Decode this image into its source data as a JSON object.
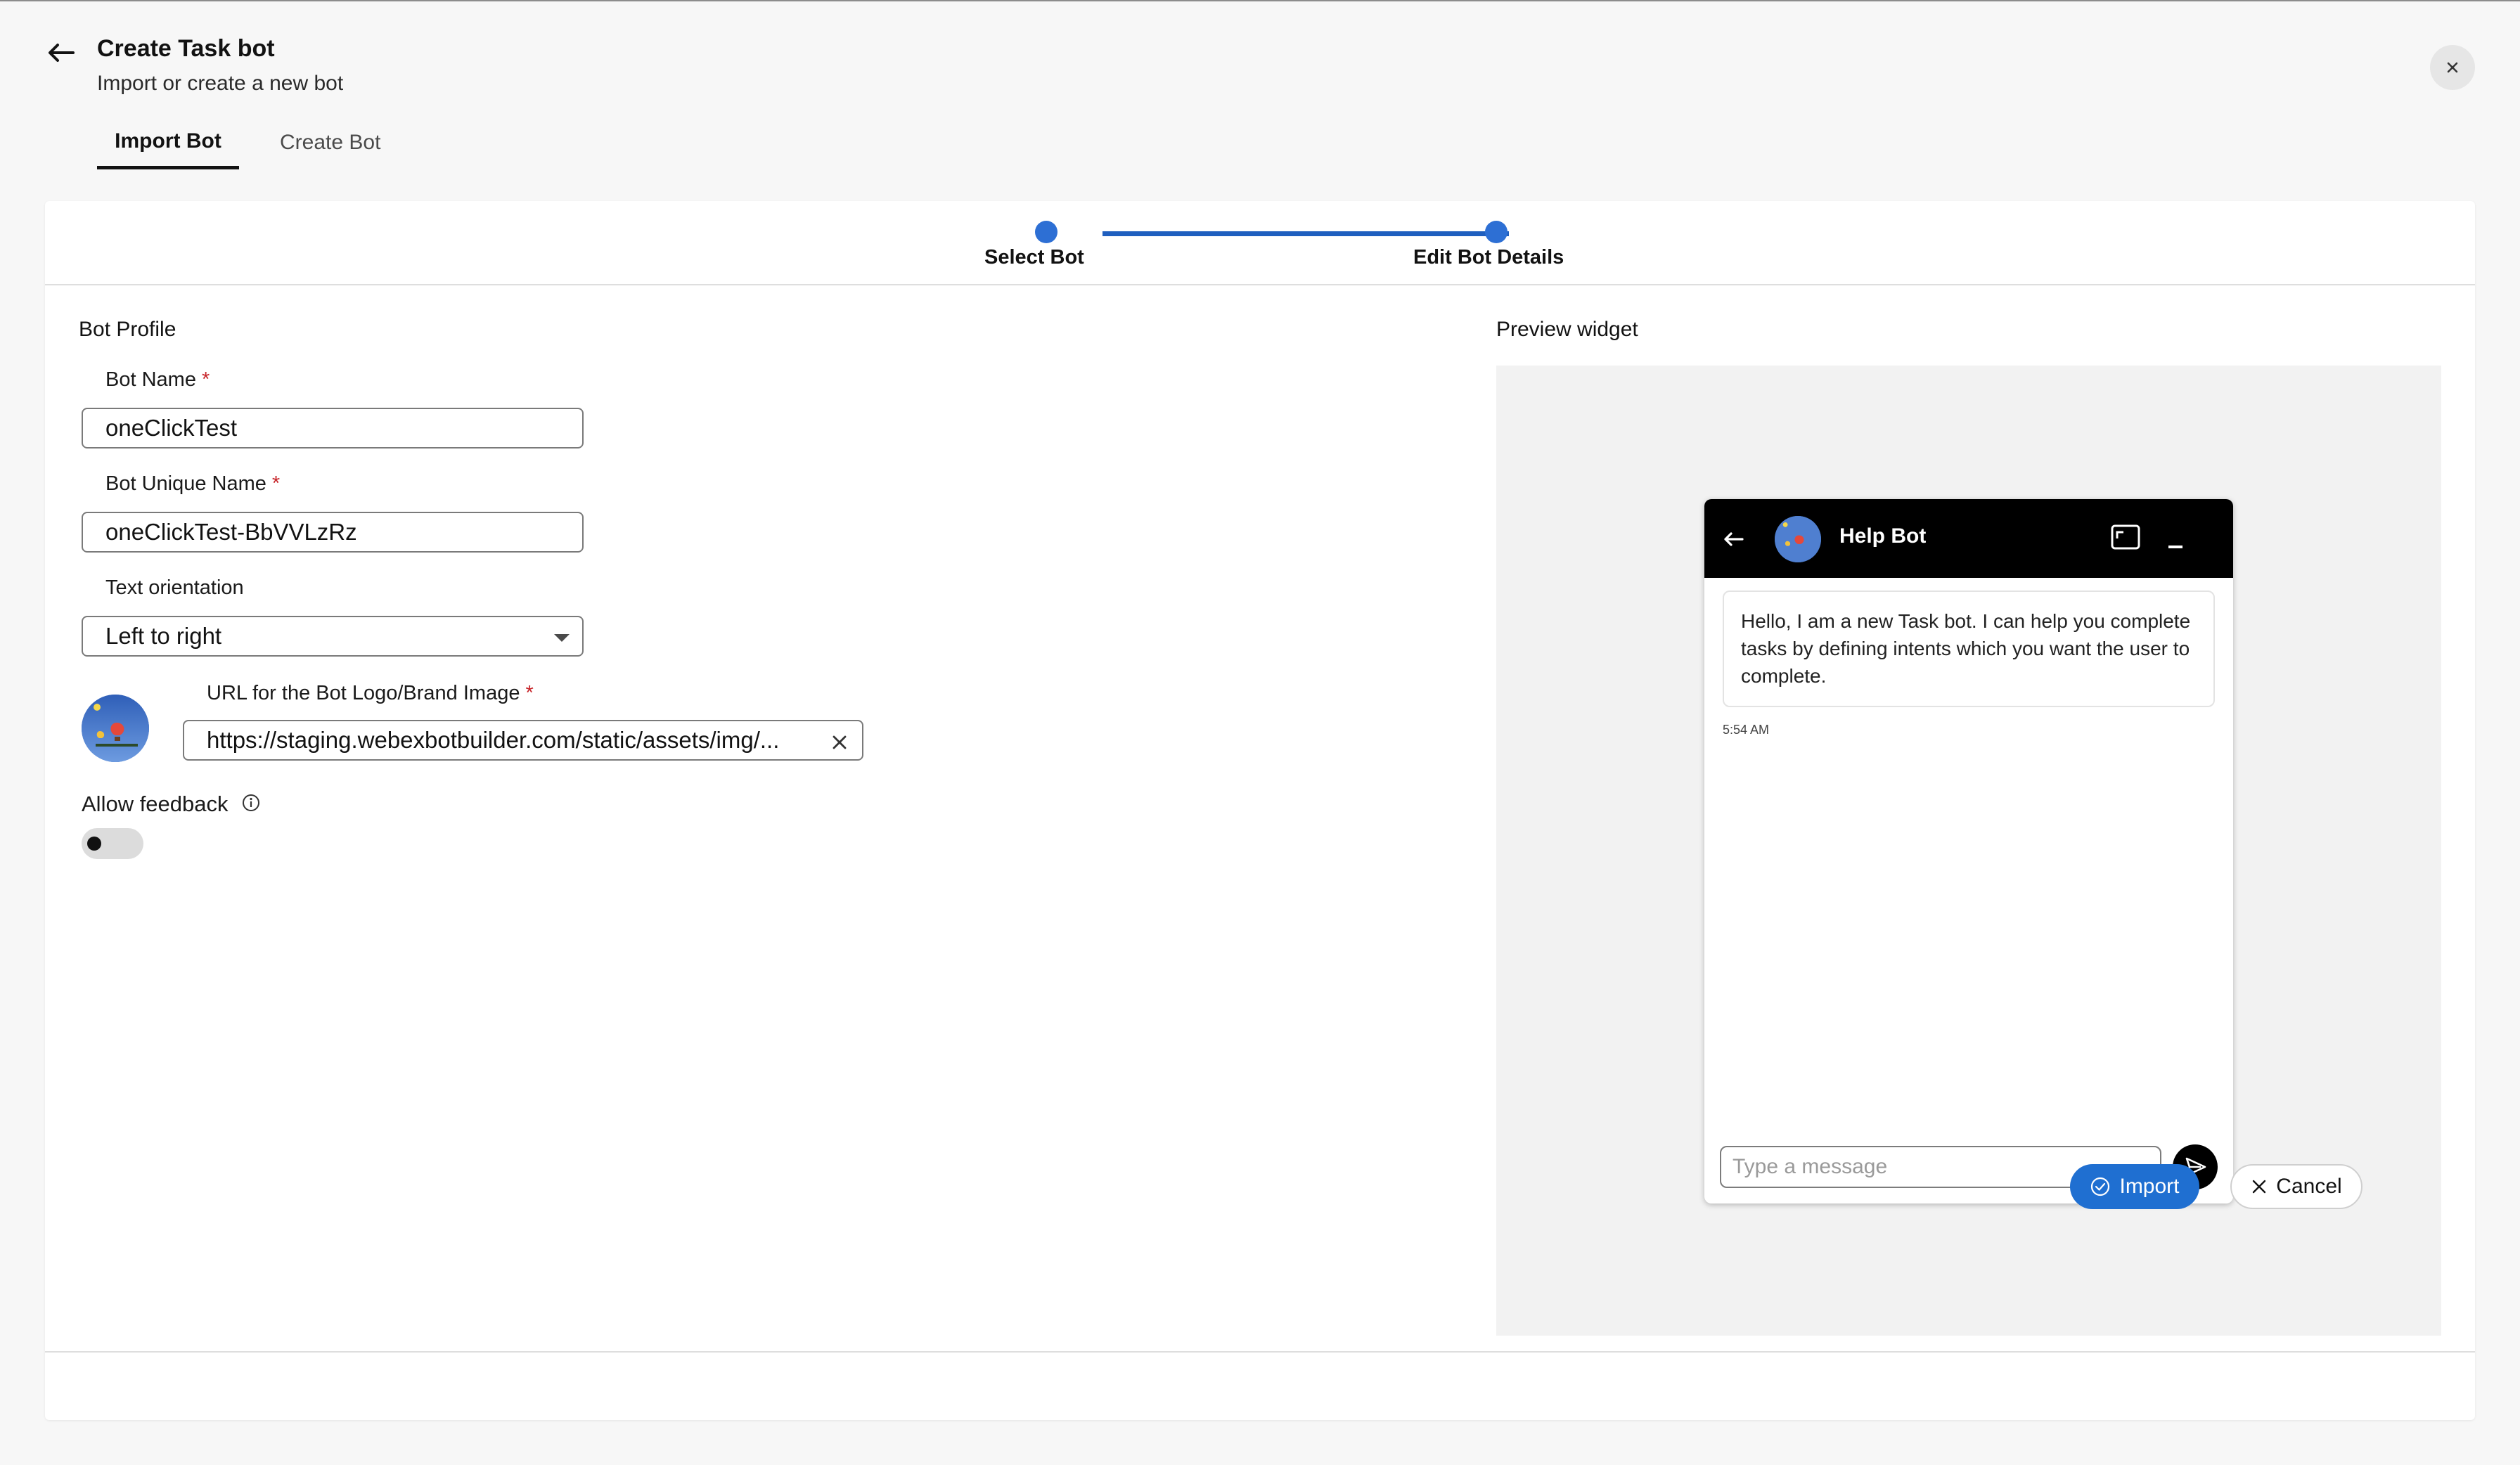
{
  "header": {
    "title": "Create Task bot",
    "subtitle": "Import or create a new bot",
    "tabs": [
      {
        "label": "Import Bot",
        "active": true
      },
      {
        "label": "Create Bot",
        "active": false
      }
    ]
  },
  "stepper": {
    "steps": [
      {
        "label": "Select Bot",
        "completed": true
      },
      {
        "label": "Edit Bot Details",
        "completed": true
      }
    ]
  },
  "profile": {
    "section_title": "Bot Profile",
    "bot_name_label": "Bot Name",
    "bot_name_value": "oneClickTest",
    "unique_name_label": "Bot Unique Name",
    "unique_name_value": "oneClickTest-BbVVLzRz",
    "orientation_label": "Text orientation",
    "orientation_value": "Left to right",
    "logo_url_label": "URL for the Bot Logo/Brand Image",
    "logo_url_value": "https://staging.webexbotbuilder.com/static/assets/img/...",
    "required_mark": "*",
    "feedback_label": "Allow feedback",
    "feedback_enabled": false
  },
  "preview": {
    "section_title": "Preview widget",
    "bot_title": "Help Bot",
    "message": "Hello, I am a new Task bot. I can help you complete tasks by defining intents which you want the user to complete.",
    "time": "5:54 AM",
    "input_placeholder": "Type a message"
  },
  "footer": {
    "import_label": "Import",
    "cancel_label": "Cancel"
  },
  "colors": {
    "accent": "#1f6fd1",
    "stepper": "#2d6fd4",
    "required": "#c7252a"
  }
}
